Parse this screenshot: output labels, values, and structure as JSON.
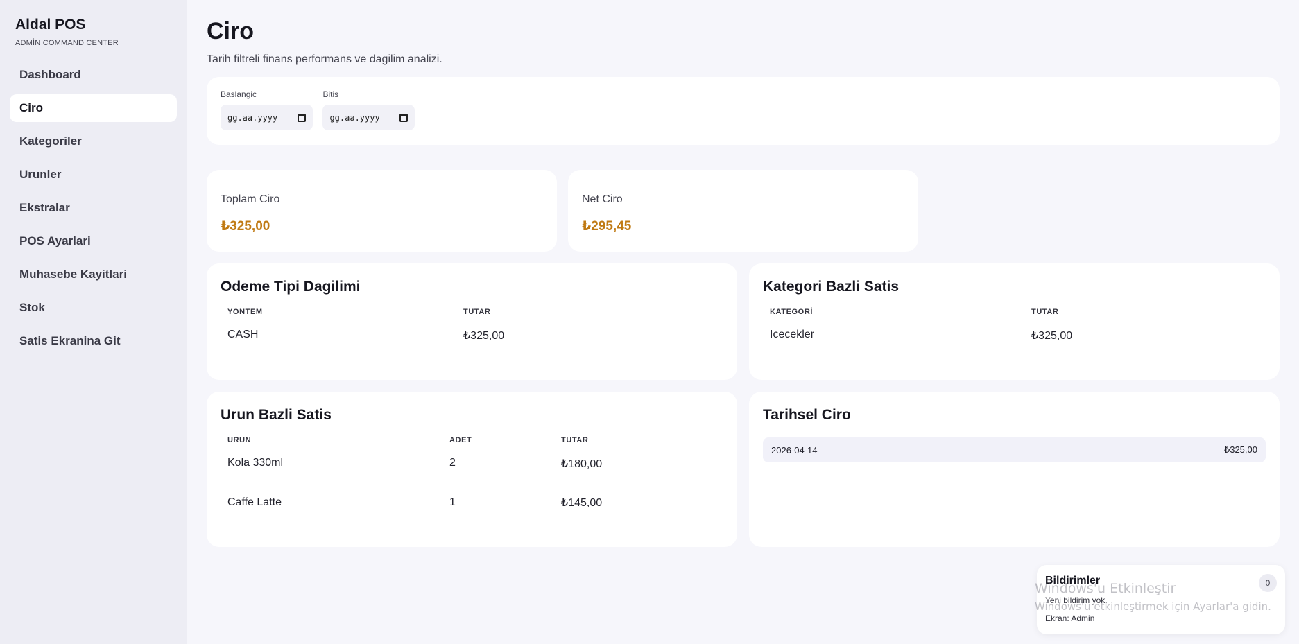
{
  "sidebar": {
    "brand": "Aldal POS",
    "subtitle": "ADMİN COMMAND CENTER",
    "items": [
      {
        "label": "Dashboard"
      },
      {
        "label": "Ciro"
      },
      {
        "label": "Kategoriler"
      },
      {
        "label": "Urunler"
      },
      {
        "label": "Ekstralar"
      },
      {
        "label": "POS Ayarlari"
      },
      {
        "label": "Muhasebe Kayitlari"
      },
      {
        "label": "Stok"
      },
      {
        "label": "Satis Ekranina Git"
      }
    ],
    "active_index": 1
  },
  "page": {
    "title": "Ciro",
    "subtitle": "Tarih filtreli finans performans ve dagilim analizi."
  },
  "filters": {
    "start_label": "Baslangic",
    "start_value": "gg.aa.yyyy",
    "end_label": "Bitis",
    "end_value": "gg.aa.yyyy"
  },
  "kpis": [
    {
      "label": "Toplam Ciro",
      "value": "₺325,00"
    },
    {
      "label": "Net Ciro",
      "value": "₺295,45"
    }
  ],
  "payment": {
    "title": "Odeme Tipi Dagilimi",
    "headers": [
      "YONTEM",
      "TUTAR"
    ],
    "rows": [
      [
        "CASH",
        "₺325,00"
      ]
    ]
  },
  "category": {
    "title": "Kategori Bazli Satis",
    "headers": [
      "KATEGORİ",
      "TUTAR"
    ],
    "rows": [
      [
        "Icecekler",
        "₺325,00"
      ]
    ]
  },
  "product": {
    "title": "Urun Bazli Satis",
    "headers": [
      "URUN",
      "ADET",
      "TUTAR"
    ],
    "rows": [
      [
        "Kola 330ml",
        "2",
        "₺180,00"
      ],
      [
        "Caffe Latte",
        "1",
        "₺145,00"
      ]
    ]
  },
  "history": {
    "title": "Tarihsel Ciro",
    "rows": [
      {
        "date": "2026-04-14",
        "amount": "₺325,00"
      }
    ]
  },
  "notifications": {
    "title": "Bildirimler",
    "count": "0",
    "empty": "Yeni bildirim yok.",
    "screen": "Ekran: Admin"
  },
  "watermark": {
    "line1": "Windows'u Etkinleştir",
    "line2": "Windows'u etkinleştirmek için Ayarlar'a gidin."
  },
  "colors": {
    "accent": "#c07a14",
    "sidebar_bg": "#ededf4",
    "page_bg": "#f6f6fb"
  }
}
